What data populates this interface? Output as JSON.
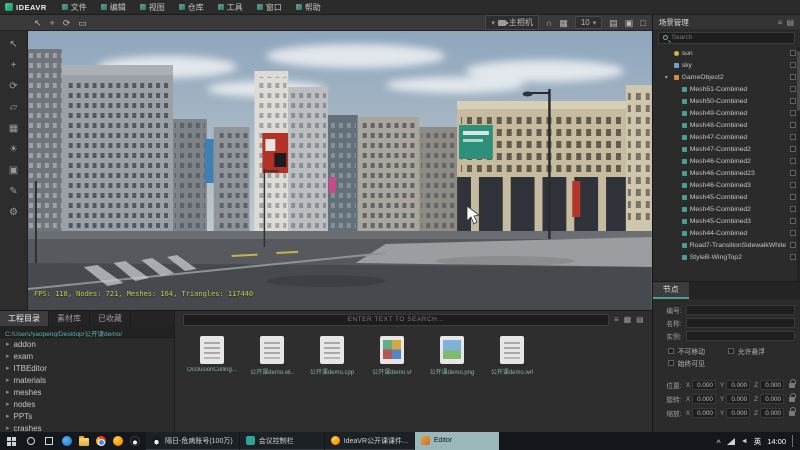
{
  "app": {
    "logo_text": "IDEAVR"
  },
  "menubar": {
    "items": [
      {
        "label": "文件"
      },
      {
        "label": "编辑"
      },
      {
        "label": "视图"
      },
      {
        "label": "仓库"
      },
      {
        "label": "工具"
      },
      {
        "label": "窗口"
      },
      {
        "label": "帮助"
      }
    ]
  },
  "viewport_toolbar": {
    "left_tools": [
      {
        "icon": "select"
      },
      {
        "icon": "pan"
      },
      {
        "icon": "rotate"
      },
      {
        "icon": "frame"
      }
    ],
    "camera_label": "主相机",
    "grid_size": "10"
  },
  "sidebar_tools": [
    {
      "icon": "cursor"
    },
    {
      "icon": "move"
    },
    {
      "icon": "rotate"
    },
    {
      "icon": "scale"
    },
    {
      "icon": "terrain"
    },
    {
      "icon": "light"
    },
    {
      "icon": "camera"
    },
    {
      "icon": "paint"
    },
    {
      "icon": "settings"
    }
  ],
  "viewport": {
    "stats": "FPS: 118, Nodes: 721, Meshes: 164, Triangles: 117440"
  },
  "scene_panel": {
    "title": "场景管理",
    "search_placeholder": "Search",
    "tree": [
      {
        "label": "sun",
        "level": 1,
        "icon": "sun"
      },
      {
        "label": "sky",
        "level": 1,
        "icon": "sky"
      },
      {
        "label": "GameObject2",
        "level": 1,
        "icon": "group",
        "expanded": true
      },
      {
        "label": "Mesh51-Combined",
        "level": 2,
        "icon": "mesh"
      },
      {
        "label": "Mesh50-Combined",
        "level": 2,
        "icon": "mesh"
      },
      {
        "label": "Mesh49-Combined",
        "level": 2,
        "icon": "mesh"
      },
      {
        "label": "Mesh48-Combined",
        "level": 2,
        "icon": "mesh"
      },
      {
        "label": "Mesh47-Combined",
        "level": 2,
        "icon": "mesh"
      },
      {
        "label": "Mesh47-Combined2",
        "level": 2,
        "icon": "mesh"
      },
      {
        "label": "Mesh46-Combined2",
        "level": 2,
        "icon": "mesh"
      },
      {
        "label": "Mesh46-Combined23",
        "level": 2,
        "icon": "mesh"
      },
      {
        "label": "Mesh46-Combined3",
        "level": 2,
        "icon": "mesh"
      },
      {
        "label": "Mesh45-Combined",
        "level": 2,
        "icon": "mesh"
      },
      {
        "label": "Mesh45-Combined2",
        "level": 2,
        "icon": "mesh"
      },
      {
        "label": "Mesh45-Combined3",
        "level": 2,
        "icon": "mesh"
      },
      {
        "label": "Mesh44-Combined",
        "level": 2,
        "icon": "mesh"
      },
      {
        "label": "Road7-TransitionSidewalkWhite",
        "level": 2,
        "icon": "mesh"
      },
      {
        "label": "StyleB-WingTop2",
        "level": 2,
        "icon": "mesh"
      }
    ]
  },
  "properties_panel": {
    "tab_label": "节点",
    "fields": [
      {
        "label": "编号:",
        "value": ""
      },
      {
        "label": "名称:",
        "value": ""
      },
      {
        "label": "实例:",
        "value": ""
      }
    ],
    "checkboxes": [
      {
        "label": "不可移动"
      },
      {
        "label": "允许悬浮"
      },
      {
        "label": "始终可见"
      }
    ],
    "transforms": [
      {
        "label": "位置:",
        "x": "0.000",
        "y": "0.000",
        "z": "0.000"
      },
      {
        "label": "旋转:",
        "x": "0.000",
        "y": "0.000",
        "z": "0.000"
      },
      {
        "label": "缩放:",
        "x": "0.000",
        "y": "0.000",
        "z": "0.000"
      }
    ]
  },
  "project_panel": {
    "tabs": [
      {
        "label": "工程目录",
        "active": true
      },
      {
        "label": "素材库"
      },
      {
        "label": "已收藏"
      }
    ],
    "path": "C:/Users/yaopeng/Desktop/公开课demo/",
    "folders": [
      {
        "name": "addon"
      },
      {
        "name": "exam"
      },
      {
        "name": "ITBEditor"
      },
      {
        "name": "materials"
      },
      {
        "name": "meshes"
      },
      {
        "name": "nodes"
      },
      {
        "name": "PPTs"
      },
      {
        "name": "crashes"
      }
    ]
  },
  "assets_panel": {
    "search_placeholder": "ENTER TEXT TO SEARCH...",
    "files": [
      {
        "name": "OcclusionCulling...",
        "type": "doc"
      },
      {
        "name": "公开课demo.wl..",
        "type": "doc"
      },
      {
        "name": "公开课demo.cpp",
        "type": "doc"
      },
      {
        "name": "公开课demo.vr",
        "type": "vr"
      },
      {
        "name": "公开课demo.png",
        "type": "image"
      },
      {
        "name": "公开课demo.wrl",
        "type": "doc"
      }
    ]
  },
  "taskbar": {
    "quick_icons": [
      {
        "icon": "edge"
      },
      {
        "icon": "file-explorer"
      },
      {
        "icon": "chrome"
      },
      {
        "icon": "firefox"
      },
      {
        "icon": "qq"
      }
    ],
    "apps": [
      {
        "title": "隔日-危病账号(100万)",
        "icon": "qq"
      },
      {
        "title": "会议控制栏",
        "icon": "meeting"
      },
      {
        "title": "IdeaVR公开课课件...",
        "icon": "firefox"
      },
      {
        "title": "Editor",
        "icon": "editor",
        "active": true
      }
    ],
    "tray": {
      "lang": "英",
      "time": "14:00"
    }
  },
  "colors": {
    "accent": "#4d9e94",
    "stats_text": "#b9cf49"
  }
}
